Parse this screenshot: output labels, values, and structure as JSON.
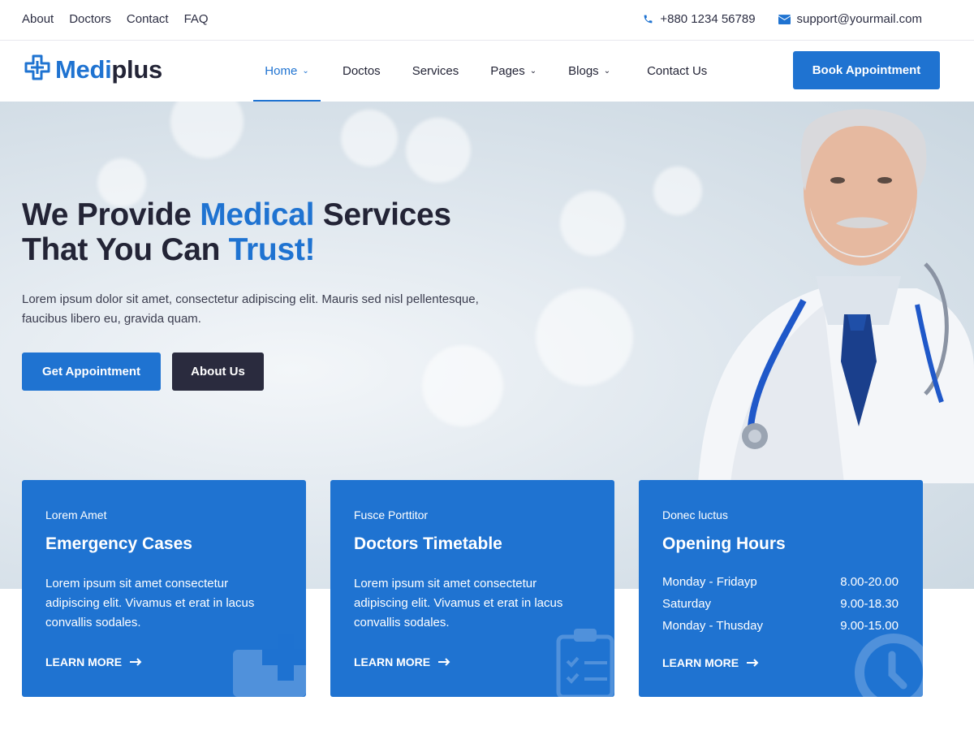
{
  "topbar": {
    "links": [
      "About",
      "Doctors",
      "Contact",
      "FAQ"
    ],
    "phone": "+880 1234 56789",
    "email": "support@yourmail.com"
  },
  "header": {
    "logo_part1": "Medi",
    "logo_part2": "plus",
    "nav": [
      {
        "label": "Home",
        "dropdown": true,
        "active": true
      },
      {
        "label": "Doctos",
        "dropdown": false
      },
      {
        "label": "Services",
        "dropdown": false
      },
      {
        "label": "Pages",
        "dropdown": true
      },
      {
        "label": "Blogs",
        "dropdown": true
      },
      {
        "label": "Contact Us",
        "dropdown": false
      }
    ],
    "book_button": "Book Appointment"
  },
  "hero": {
    "title_line1_a": "We Provide ",
    "title_line1_b": "Medical",
    "title_line1_c": " Services",
    "title_line2_a": "That You Can ",
    "title_line2_b": "Trust!",
    "lead": "Lorem ipsum dolor sit amet, consectetur adipiscing elit. Mauris sed nisl pellentesque, faucibus libero eu, gravida quam.",
    "primary_button": "Get Appointment",
    "secondary_button": "About Us"
  },
  "cards": [
    {
      "eyebrow": "Lorem Amet",
      "title": "Emergency Cases",
      "text": "Lorem ipsum sit amet consectetur adipiscing elit. Vivamus et erat in lacus convallis sodales.",
      "more": "LEARN MORE",
      "icon": "first-aid-kit-icon"
    },
    {
      "eyebrow": "Fusce Porttitor",
      "title": "Doctors Timetable",
      "text": "Lorem ipsum sit amet consectetur adipiscing elit. Vivamus et erat in lacus convallis sodales.",
      "more": "LEARN MORE",
      "icon": "clipboard-checklist-icon"
    },
    {
      "eyebrow": "Donec luctus",
      "title": "Opening Hours",
      "hours": [
        {
          "day": "Monday - Fridayp",
          "time": "8.00-20.00"
        },
        {
          "day": "Saturday",
          "time": "9.00-18.30"
        },
        {
          "day": "Monday - Thusday",
          "time": "9.00-15.00"
        }
      ],
      "more": "LEARN MORE",
      "icon": "clock-icon"
    }
  ],
  "colors": {
    "accent": "#1f73d1",
    "dark": "#232436",
    "dark_button": "#2a2b3e"
  }
}
